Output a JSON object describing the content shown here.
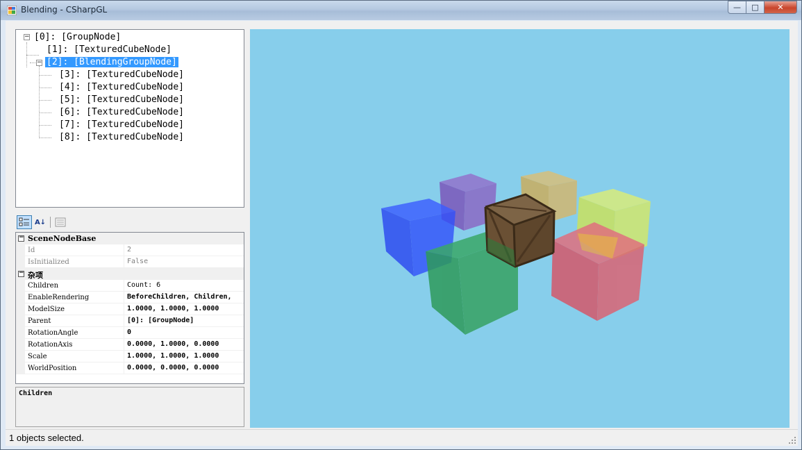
{
  "window": {
    "title": "Blending - CSharpGL",
    "min_glyph": "—",
    "max_glyph": "□",
    "close_glyph": "✕",
    "icon": "app-icon"
  },
  "tree": {
    "nodes": [
      {
        "label": "[0]: [GroupNode]"
      },
      {
        "label": "[1]: [TexturedCubeNode]"
      },
      {
        "label": "[2]: [BlendingGroupNode]",
        "selected": true
      },
      {
        "label": "[3]: [TexturedCubeNode]"
      },
      {
        "label": "[4]: [TexturedCubeNode]"
      },
      {
        "label": "[5]: [TexturedCubeNode]"
      },
      {
        "label": "[6]: [TexturedCubeNode]"
      },
      {
        "label": "[7]: [TexturedCubeNode]"
      },
      {
        "label": "[8]: [TexturedCubeNode]"
      }
    ],
    "collapse_glyph": "−"
  },
  "toolbar": {
    "categorized_icon": "categorized-icon",
    "alphabetical_icon": "alphabetical-icon",
    "property_pages_icon": "property-pages-icon",
    "alpha_glyph": "A↓"
  },
  "property_grid": {
    "categories": [
      {
        "name": "SceneNodeBase",
        "properties": [
          {
            "name": "Id",
            "value": "2",
            "readonly": true
          },
          {
            "name": "IsInitialized",
            "value": "False",
            "readonly": true
          }
        ]
      },
      {
        "name": "杂项",
        "properties": [
          {
            "name": "Children",
            "value": "Count: 6",
            "readonly": false,
            "bold": false
          },
          {
            "name": "EnableRendering",
            "value": "BeforeChildren, Children, ",
            "readonly": false
          },
          {
            "name": "ModelSize",
            "value": "1.0000, 1.0000, 1.0000",
            "readonly": false
          },
          {
            "name": "Parent",
            "value": "[0]: [GroupNode]",
            "readonly": false
          },
          {
            "name": "RotationAngle",
            "value": "0",
            "readonly": false
          },
          {
            "name": "RotationAxis",
            "value": "0.0000, 1.0000, 0.0000",
            "readonly": false
          },
          {
            "name": "Scale",
            "value": "1.0000, 1.0000, 1.0000",
            "readonly": false
          },
          {
            "name": "WorldPosition",
            "value": "0.0000, 0.0000, 0.0000",
            "readonly": false
          }
        ]
      }
    ],
    "description_title": "Children"
  },
  "viewport": {
    "background": "#87ceeb",
    "cubes": [
      {
        "name": "blue-cube",
        "color": "#2a4bff"
      },
      {
        "name": "purple-cube",
        "color": "#8a4fc0"
      },
      {
        "name": "orange-cube",
        "color": "#d9b05a"
      },
      {
        "name": "yellow-cube",
        "color": "#d8ea55"
      },
      {
        "name": "green-cube",
        "color": "#2f9c5a"
      },
      {
        "name": "red-cube",
        "color": "#d65a6e"
      },
      {
        "name": "wooden-crate",
        "color": "#6b5236"
      }
    ]
  },
  "status": {
    "text": "1 objects selected."
  }
}
